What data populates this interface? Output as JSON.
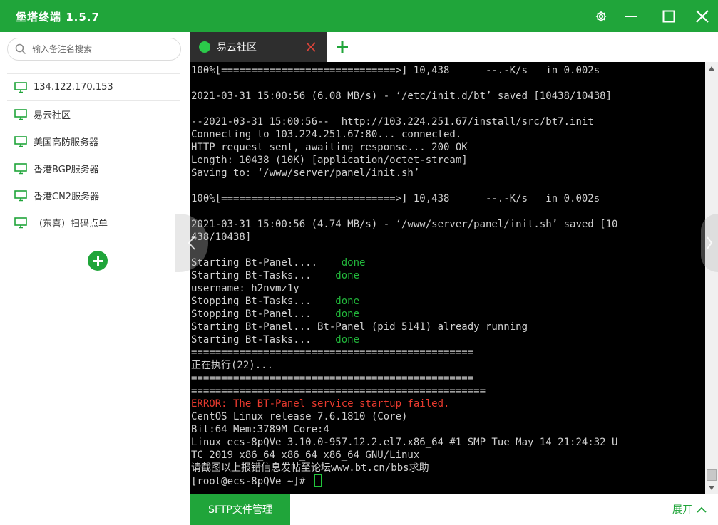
{
  "app": {
    "title": "堡塔终端 1.5.7"
  },
  "window_controls": [
    "gear-icon",
    "minimize-icon",
    "maximize-icon",
    "close-icon"
  ],
  "sidebar": {
    "search_placeholder": "输入备注名搜索",
    "items": [
      {
        "label": "134.122.170.153",
        "icon": "monitor-icon"
      },
      {
        "label": "易云社区",
        "icon": "monitor-icon"
      },
      {
        "label": "美国高防服务器",
        "icon": "monitor-icon"
      },
      {
        "label": "香港BGP服务器",
        "icon": "monitor-icon"
      },
      {
        "label": "香港CN2服务器",
        "icon": "monitor-icon"
      },
      {
        "label": "（东喜）扫码点单",
        "icon": "monitor-icon"
      }
    ]
  },
  "tabs": [
    {
      "label": "易云社区",
      "status": "connected"
    }
  ],
  "terminal": {
    "lines": [
      [
        {
          "t": "100%[=============================>] 10,438      --.-K/s   in 0.002s"
        }
      ],
      [
        {
          "t": ""
        }
      ],
      [
        {
          "t": "2021-03-31 15:00:56 (6.08 MB/s) - ‘/etc/init.d/bt’ saved [10438/10438]"
        }
      ],
      [
        {
          "t": ""
        }
      ],
      [
        {
          "t": "--2021-03-31 15:00:56--  http://103.224.251.67/install/src/bt7.init"
        }
      ],
      [
        {
          "t": "Connecting to 103.224.251.67:80... connected."
        }
      ],
      [
        {
          "t": "HTTP request sent, awaiting response... 200 OK"
        }
      ],
      [
        {
          "t": "Length: 10438 (10K) [application/octet-stream]"
        }
      ],
      [
        {
          "t": "Saving to: ‘/www/server/panel/init.sh’"
        }
      ],
      [
        {
          "t": ""
        }
      ],
      [
        {
          "t": "100%[=============================>] 10,438      --.-K/s   in 0.002s"
        }
      ],
      [
        {
          "t": ""
        }
      ],
      [
        {
          "t": "2021-03-31 15:00:56 (4.74 MB/s) - ‘/www/server/panel/init.sh’ saved [10"
        }
      ],
      [
        {
          "t": "438/10438]"
        }
      ],
      [
        {
          "t": ""
        }
      ],
      [
        {
          "t": "Starting Bt-Panel....    "
        },
        {
          "t": "done",
          "c": "done"
        }
      ],
      [
        {
          "t": "Starting Bt-Tasks...    "
        },
        {
          "t": "done",
          "c": "done"
        }
      ],
      [
        {
          "t": "username: h2nvmz1y"
        }
      ],
      [
        {
          "t": "Stopping Bt-Tasks...    "
        },
        {
          "t": "done",
          "c": "done"
        }
      ],
      [
        {
          "t": "Stopping Bt-Panel...    "
        },
        {
          "t": "done",
          "c": "done"
        }
      ],
      [
        {
          "t": "Starting Bt-Panel... Bt-Panel (pid 5141) already running"
        }
      ],
      [
        {
          "t": "Starting Bt-Tasks...    "
        },
        {
          "t": "done",
          "c": "done"
        }
      ],
      [
        {
          "t": "==============================================="
        }
      ],
      [
        {
          "t": "正在执行(22)..."
        }
      ],
      [
        {
          "t": "==============================================="
        }
      ],
      [
        {
          "t": "================================================="
        }
      ],
      [
        {
          "t": "ERROR: The BT-Panel service startup failed.",
          "c": "error"
        }
      ],
      [
        {
          "t": "CentOS Linux release 7.6.1810 (Core)"
        }
      ],
      [
        {
          "t": "Bit:64 Mem:3789M Core:4"
        }
      ],
      [
        {
          "t": "Linux ecs-8pQVe 3.10.0-957.12.2.el7.x86_64 #1 SMP Tue May 14 21:24:32 U"
        }
      ],
      [
        {
          "t": "TC 2019 x86_64 x86_64 x86_64 GNU/Linux"
        }
      ],
      [
        {
          "t": "请截图以上报错信息发帖至论坛www.bt.cn/bbs求助"
        }
      ],
      [
        {
          "t": "[root@ecs-8pQVe ~]# "
        },
        {
          "t": "",
          "c": "cursor"
        }
      ]
    ]
  },
  "bottom": {
    "sftp_label": "SFTP文件管理",
    "expand_label": "展开"
  },
  "colors": {
    "accent": "#20a53a",
    "done": "#22b83b",
    "error": "#e83a2e",
    "terminal_bg": "#000000",
    "tab_bg": "#2e2e2e"
  }
}
